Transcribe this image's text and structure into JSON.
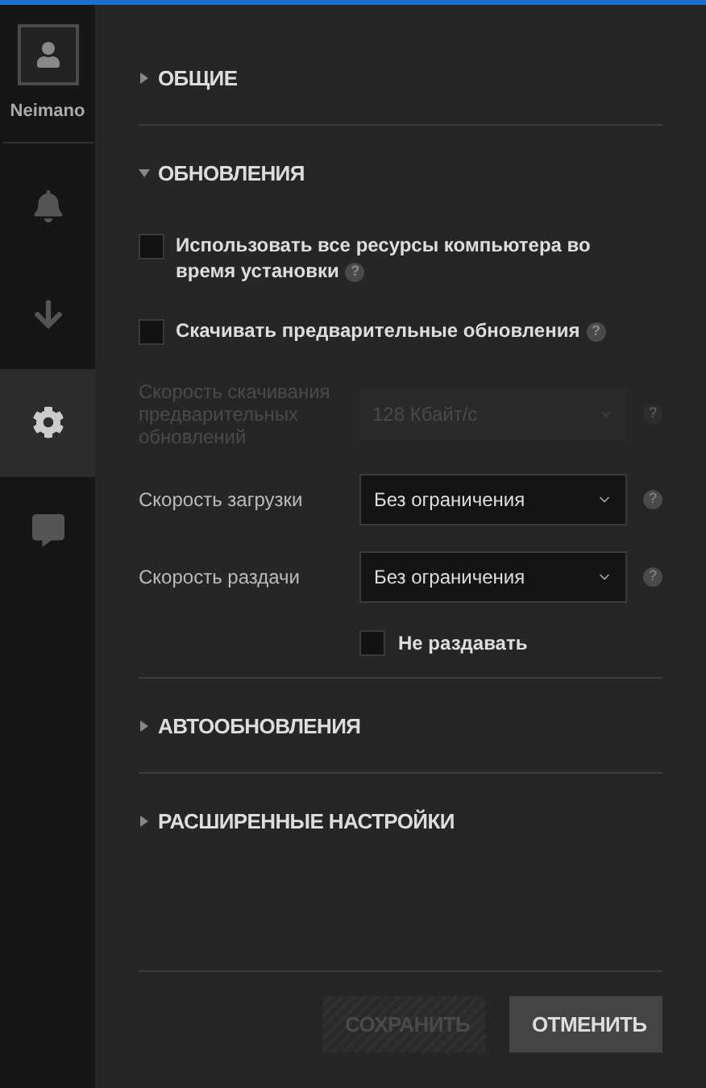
{
  "sidebar": {
    "user": {
      "name": "Neimano"
    },
    "nav": [
      {
        "kind": "bell",
        "selected": false
      },
      {
        "kind": "download",
        "selected": false
      },
      {
        "kind": "gear",
        "selected": true
      },
      {
        "kind": "chat",
        "selected": false
      }
    ]
  },
  "sections": [
    {
      "title": "ОБЩИЕ",
      "expanded": false
    },
    {
      "title": "ОБНОВЛЕНИЯ",
      "expanded": true,
      "settings": [
        {
          "kind": "checkbox",
          "label": "Использовать все ресурсы компьютера во время установки",
          "checked": false,
          "help": "?"
        },
        {
          "kind": "checkbox",
          "label": "Скачивать предварительные обновления",
          "checked": false,
          "help": "?"
        },
        {
          "kind": "select",
          "label": "Скорость скачивания предварительных обновлений",
          "value": "128 Кбайт/с",
          "disabled": true,
          "help": "?"
        },
        {
          "kind": "select",
          "label": "Скорость загрузки",
          "value": "Без ограничения",
          "disabled": false,
          "help": "?"
        },
        {
          "kind": "select",
          "label": "Скорость раздачи",
          "value": "Без ограничения",
          "disabled": false,
          "help": "?"
        },
        {
          "kind": "subcheckbox",
          "label": "Не раздавать",
          "checked": false
        }
      ]
    },
    {
      "title": "АВТООБНОВЛЕНИЯ",
      "expanded": false
    },
    {
      "title": "РАСШИРЕННЫЕ НАСТРОЙКИ",
      "expanded": false
    }
  ],
  "buttons": [
    {
      "label": "СОХРАНИТЬ",
      "disabled": true
    },
    {
      "label": "ОТМЕНИТЬ",
      "disabled": false
    }
  ]
}
